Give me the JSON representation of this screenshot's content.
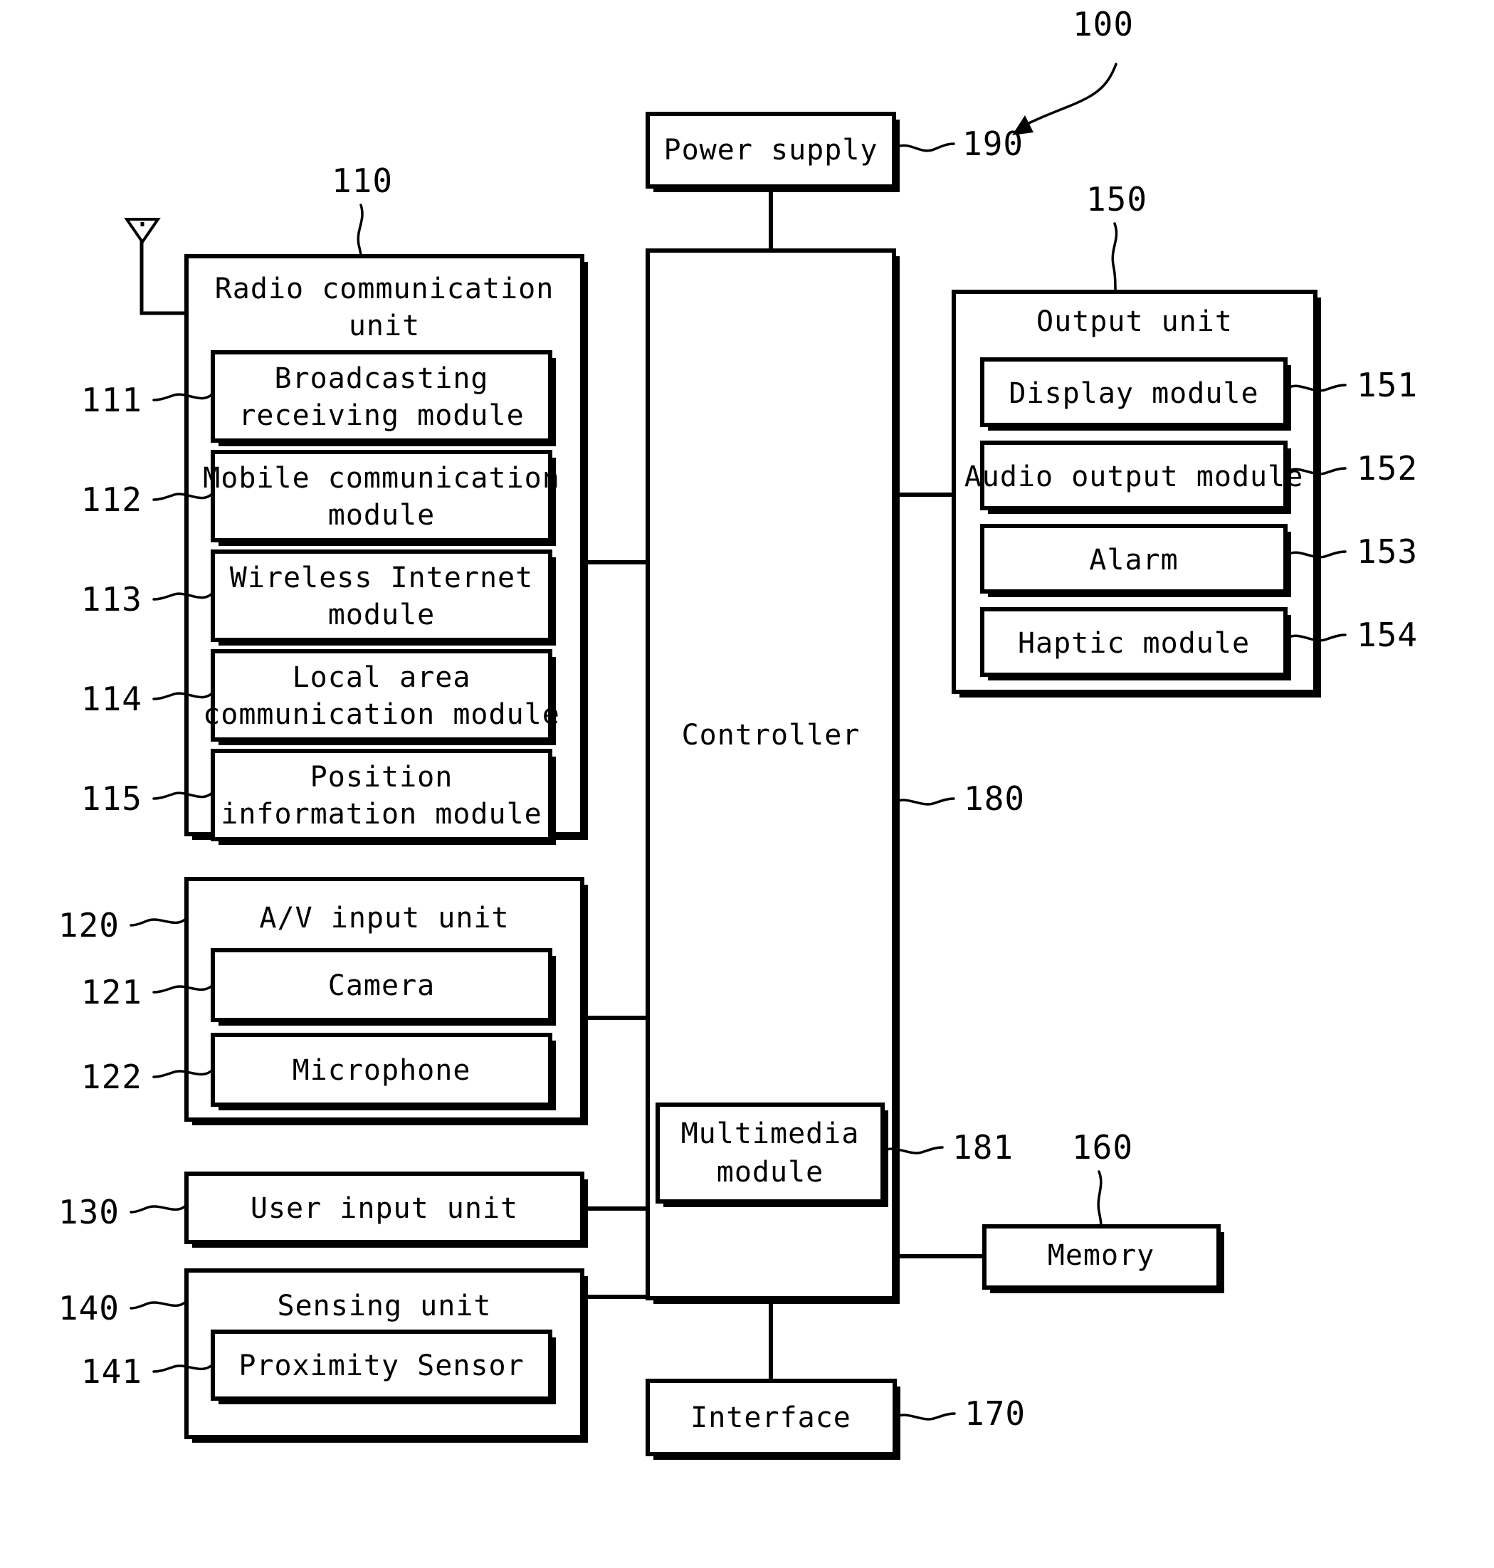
{
  "figure": {
    "type": "patent-block-diagram",
    "overall_ref": "100",
    "background": "#ffffff",
    "ink": "#000000"
  },
  "blocks": {
    "power_supply": {
      "label": "Power supply",
      "ref": "190"
    },
    "radio_unit": {
      "label_line1": "Radio communication",
      "label_line2": "unit",
      "ref": "110"
    },
    "broadcasting": {
      "label_line1": "Broadcasting",
      "label_line2": "receiving module",
      "ref": "111"
    },
    "mobile_comm": {
      "label_line1": "Mobile communication",
      "label_line2": "module",
      "ref": "112"
    },
    "wireless_internet": {
      "label_line1": "Wireless Internet",
      "label_line2": "module",
      "ref": "113"
    },
    "local_area": {
      "label_line1": "Local area",
      "label_line2": "communication module",
      "ref": "114"
    },
    "position_info": {
      "label_line1": "Position",
      "label_line2": "information module",
      "ref": "115"
    },
    "av_input": {
      "label": "A/V input unit",
      "ref": "120"
    },
    "camera": {
      "label": "Camera",
      "ref": "121"
    },
    "microphone": {
      "label": "Microphone",
      "ref": "122"
    },
    "user_input": {
      "label": "User input unit",
      "ref": "130"
    },
    "sensing_unit": {
      "label": "Sensing unit",
      "ref": "140"
    },
    "proximity_sensor": {
      "label": "Proximity Sensor",
      "ref": "141"
    },
    "controller": {
      "label": "Controller",
      "ref": "180"
    },
    "multimedia": {
      "label_line1": "Multimedia",
      "label_line2": "module",
      "ref": "181"
    },
    "output_unit": {
      "label": "Output unit",
      "ref": "150"
    },
    "display_module": {
      "label": "Display module",
      "ref": "151"
    },
    "audio_output": {
      "label": "Audio output module",
      "ref": "152"
    },
    "alarm": {
      "label": "Alarm",
      "ref": "153"
    },
    "haptic": {
      "label": "Haptic module",
      "ref": "154"
    },
    "memory": {
      "label": "Memory",
      "ref": "160"
    },
    "interface": {
      "label": "Interface",
      "ref": "170"
    }
  },
  "icons": {
    "antenna": "antenna-icon",
    "pointer_arrow": "arrow-icon"
  }
}
